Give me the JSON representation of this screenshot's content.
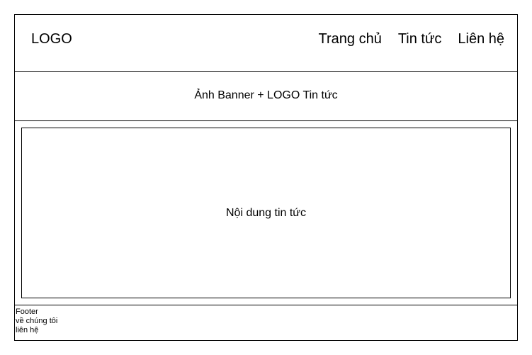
{
  "header": {
    "logo": "LOGO",
    "nav": [
      "Trang chủ",
      "Tin tức",
      "Liên hệ"
    ]
  },
  "banner": {
    "label": "Ảnh Banner + LOGO Tin tức"
  },
  "content": {
    "label": "Nội dung tin tức"
  },
  "footer": {
    "lines": [
      "Footer",
      "về chúng tôi",
      "liên hệ"
    ]
  }
}
